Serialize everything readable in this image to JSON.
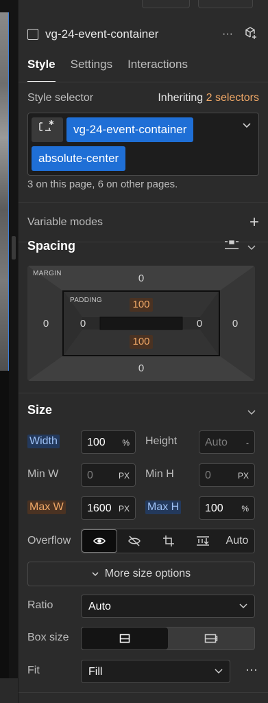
{
  "element": {
    "name": "vg-24-event-container"
  },
  "tabs": [
    {
      "label": "Style"
    },
    {
      "label": "Settings"
    },
    {
      "label": "Interactions"
    }
  ],
  "selector": {
    "label": "Style selector",
    "inheriting_text": "Inheriting",
    "inheriting_link": "2 selectors",
    "chips": [
      "vg-24-event-container",
      "absolute-center"
    ],
    "usage": "3 on this page, 6 on other pages."
  },
  "variable_modes": {
    "label": "Variable modes",
    "add": "+"
  },
  "spacing": {
    "title": "Spacing",
    "margin_label": "MARGIN",
    "padding_label": "PADDING",
    "margin": {
      "top": "0",
      "right": "0",
      "bottom": "0",
      "left": "0"
    },
    "padding": {
      "top": "100",
      "right": "0",
      "bottom": "100",
      "left": "0"
    }
  },
  "size": {
    "title": "Size",
    "width": {
      "label": "Width",
      "value": "100",
      "unit": "%"
    },
    "height": {
      "label": "Height",
      "value": "Auto",
      "unit": "-"
    },
    "min_w": {
      "label": "Min W",
      "value": "0",
      "unit": "PX"
    },
    "min_h": {
      "label": "Min H",
      "value": "0",
      "unit": "PX"
    },
    "max_w": {
      "label": "Max W",
      "value": "1600",
      "unit": "PX"
    },
    "max_h": {
      "label": "Max H",
      "value": "100",
      "unit": "%"
    },
    "overflow": {
      "label": "Overflow",
      "auto": "Auto",
      "selected": "visible"
    },
    "more": "More size options",
    "ratio": {
      "label": "Ratio",
      "value": "Auto"
    },
    "box_size": {
      "label": "Box size",
      "selected": "border-box"
    },
    "fit": {
      "label": "Fit",
      "value": "Fill"
    }
  },
  "colors": {
    "accent_blue": "#1f6fd6",
    "accent_orange": "#f0a867",
    "panel_bg": "#2b2b2b"
  }
}
